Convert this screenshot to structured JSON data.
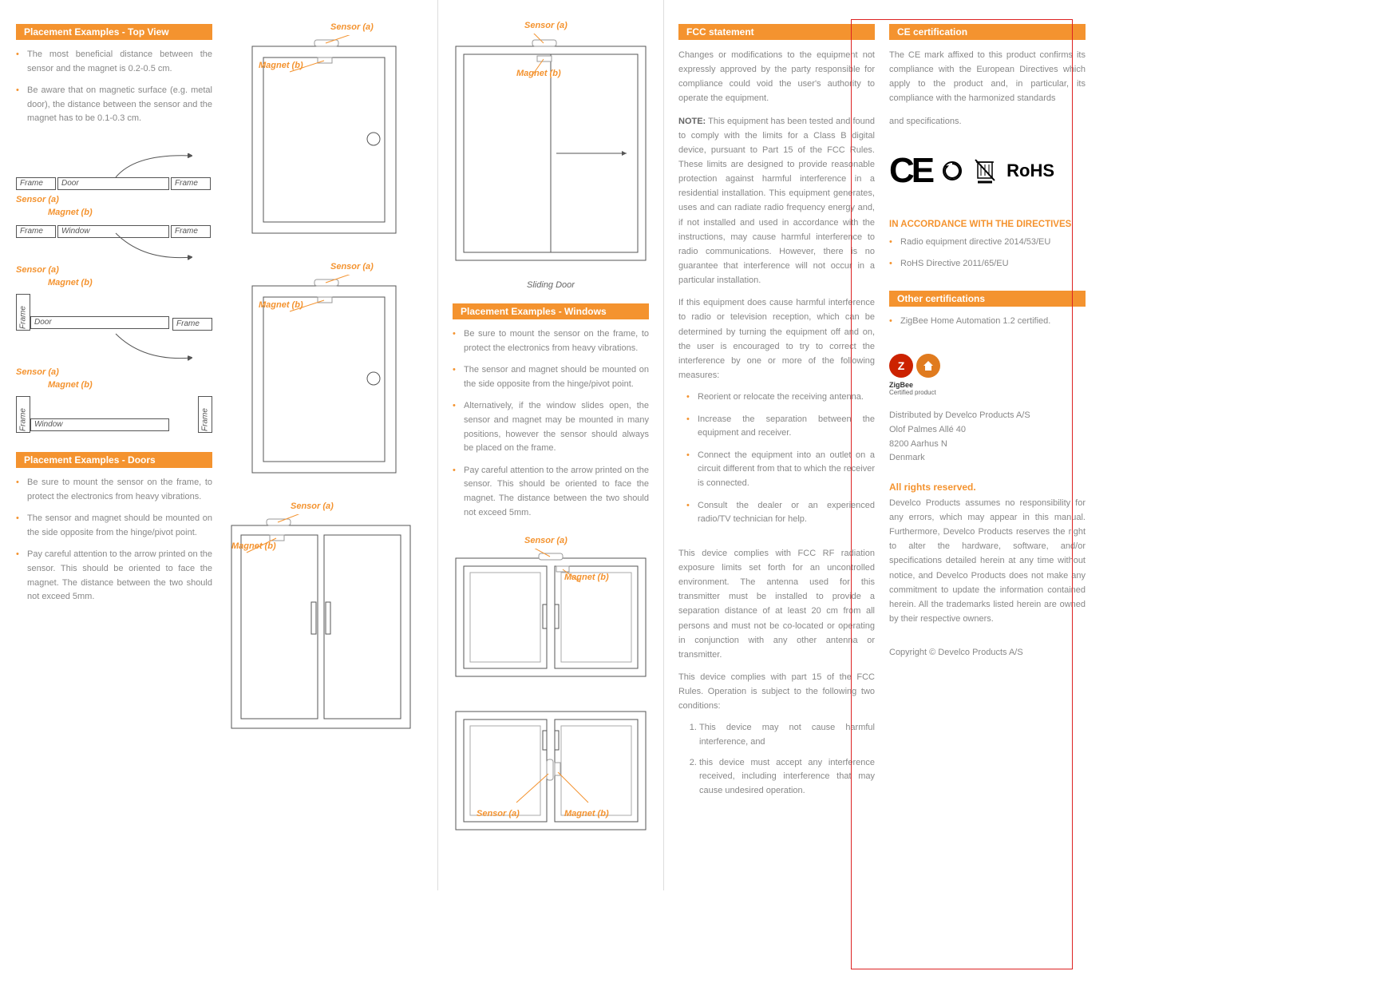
{
  "col1": {
    "heading_top": "Placement Examples - Top View",
    "top_bullets": [
      "The most beneficial distance between the sensor and the magnet is 0.2-0.5 cm.",
      "Be aware that on magnetic surface (e.g. metal door), the distance between the sensor and the magnet has to be 0.1-0.3 cm."
    ],
    "labels": {
      "frame": "Frame",
      "door": "Door",
      "window": "Window",
      "sensor_a": "Sensor (a)",
      "magnet_b": "Magnet (b)"
    },
    "heading_doors": "Placement Examples - Doors",
    "doors_bullets": [
      "Be sure to mount the sensor on the frame, to protect the electronics from heavy vibrations.",
      "The sensor and magnet should be mounted on the side opposite from the hinge/pivot point.",
      "Pay careful attention to the arrow printed on the sensor. This should be oriented to face the magnet. The distance between the two should not exceed 5mm."
    ]
  },
  "col2": {
    "labels": {
      "sensor_a": "Sensor (a)",
      "magnet_b": "Magnet (b)"
    }
  },
  "col3": {
    "labels": {
      "sensor_a": "Sensor (a)",
      "magnet_b": "Magnet (b)",
      "sliding": "Sliding Door"
    },
    "heading_windows": "Placement Examples - Windows",
    "windows_bullets": [
      "Be sure to mount the sensor on the frame, to protect the electronics from heavy vibrations.",
      "The sensor and magnet should be mounted on the side opposite from the hinge/pivot point.",
      "Alternatively, if the window slides open, the sensor and magnet may be mounted in many positions, however the sensor should always be placed on the frame.",
      "Pay careful attention to the arrow printed on the sensor. This should be oriented to face the magnet. The distance between the two should not exceed 5mm."
    ]
  },
  "col4": {
    "heading_fcc": "FCC statement",
    "p1": "Changes or modifications to the equipment not expressly approved by the party responsible for compliance could void the user's authority to operate the equipment.",
    "note_label": "NOTE:",
    "p2": " This equipment has been tested and found to comply with the limits for a Class B digital device, pursuant to Part 15 of the FCC Rules. These limits are designed to provide reasonable protection against harmful interference in a residential installation. This equipment generates, uses and can radiate radio frequency energy and, if not installed and used in accordance with the instructions, may cause harmful interference to radio communications. However, there is no guarantee that interference will not occur in a particular installation.",
    "p3": "If this equipment does cause harmful interference to radio or television reception, which can be determined by turning the equipment off and on, the user is encouraged to try to correct the interference by one or more of the following measures:",
    "measures": [
      "Reorient or relocate the receiving antenna.",
      "Increase the separation between the equipment and receiver.",
      "Connect the equipment into an outlet on a circuit different from that to which the receiver is connected.",
      "Consult the dealer or an experienced radio/TV technician for help."
    ],
    "p4": "This device complies with FCC RF radiation exposure limits set forth for an uncontrolled environment. The antenna used for this transmitter must be installed to provide a separation distance of at least 20 cm from all persons and must not be co-located or operating in conjunction with any other antenna or transmitter.",
    "p5": "This device complies with part 15 of the FCC Rules. Operation is subject to the following two conditions:",
    "conditions": [
      "This device may not cause harmful interference, and",
      "this device must accept any interference received, including interference that may cause undesired operation."
    ]
  },
  "col5": {
    "heading_ce": "CE certification",
    "ce_p1": "The CE mark affixed to this product confirms its compliance with the European Directives which apply to the product and, in particular, its compliance with the harmonized standards",
    "ce_p2": "and specifications.",
    "rohs": "RoHS",
    "directives_head": "IN ACCORDANCE WITH THE DIRECTIVES",
    "directives": [
      "Radio equipment directive 2014/53/EU",
      "RoHS Directive 2011/65/EU"
    ],
    "heading_other": "Other certifications",
    "other_bullets": [
      "ZigBee Home Automation 1.2 certified."
    ],
    "zigbee_label": "ZigBee",
    "zigbee_sub": "Certified product",
    "addr1": "Distributed by Develco Products A/S",
    "addr2": "Olof Palmes Allé 40",
    "addr3": "8200 Aarhus N",
    "addr4": "Denmark",
    "rights_head": "All rights reserved.",
    "rights_body": "Develco Products assumes no responsibility for any errors, which may appear in this manual. Furthermore, Develco Products reserves the right to alter the hardware, software, and/or specifications detailed herein at any time without notice, and Develco Products does not make any commitment to update the information contained herein. All the trademarks listed herein are owned by their respective owners.",
    "copyright": "Copyright © Develco Products A/S"
  }
}
